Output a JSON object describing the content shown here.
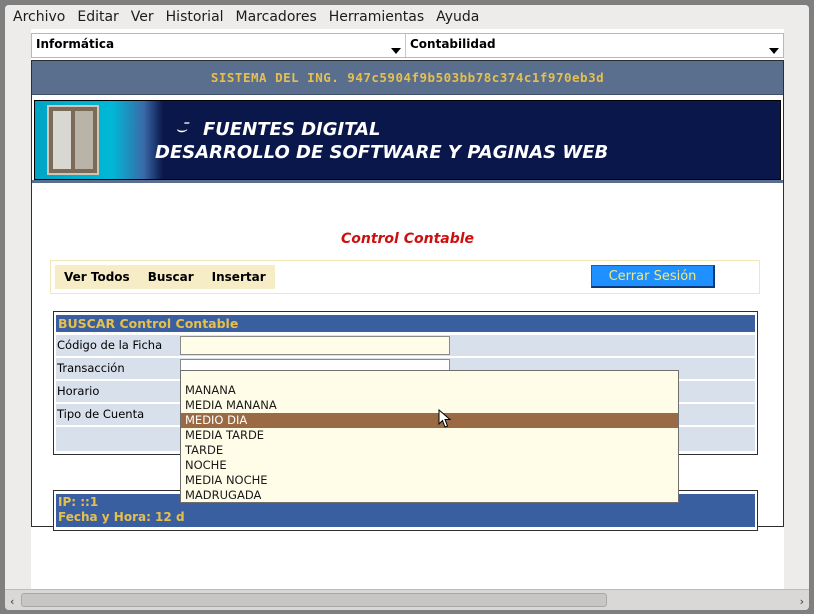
{
  "menubar": [
    {
      "label": "Archivo"
    },
    {
      "label": "Editar"
    },
    {
      "label": "Ver"
    },
    {
      "label": "Historial"
    },
    {
      "label": "Marcadores"
    },
    {
      "label": "Herramientas"
    },
    {
      "label": "Ayuda"
    }
  ],
  "top_selects": {
    "left": "Informática",
    "right": "Contabilidad"
  },
  "system_bar": "SISTEMA DEL ING. 947c5904f9b503bb78c374c1f970eb3d",
  "banner": {
    "line1": "FUENTES DIGITAL",
    "line2": "DESARROLLO DE SOFTWARE Y PAGINAS WEB"
  },
  "page_title": "Control Contable",
  "actions": {
    "ver_todos": "Ver Todos",
    "buscar": "Buscar",
    "insertar": "Insertar",
    "cerrar_sesion": "Cerrar Sesión"
  },
  "search_form": {
    "header": "BUSCAR Control Contable",
    "fields": {
      "codigo": "Código de la Ficha",
      "transaccion": "Transacción",
      "horario": "Horario",
      "tipo_cuenta": "Tipo de Cuenta"
    }
  },
  "horario_dropdown": {
    "options": [
      "MANANA",
      "MEDIA MANANA",
      "MEDIO DIA",
      "MEDIA TARDE",
      "TARDE",
      "NOCHE",
      "MEDIA NOCHE",
      "MADRUGADA"
    ],
    "highlighted": "MEDIO DIA"
  },
  "footer": {
    "ip": "IP: ::1",
    "fecha": "Fecha y Hora: 12 d"
  },
  "colors": {
    "system_bar_bg": "#5a6f8e",
    "accent_gold": "#e6c04d",
    "header_blue": "#3a5fa0",
    "title_red": "#cc1010",
    "logout_button": "#1e90ff",
    "highlight_row": "#9a6a44"
  }
}
